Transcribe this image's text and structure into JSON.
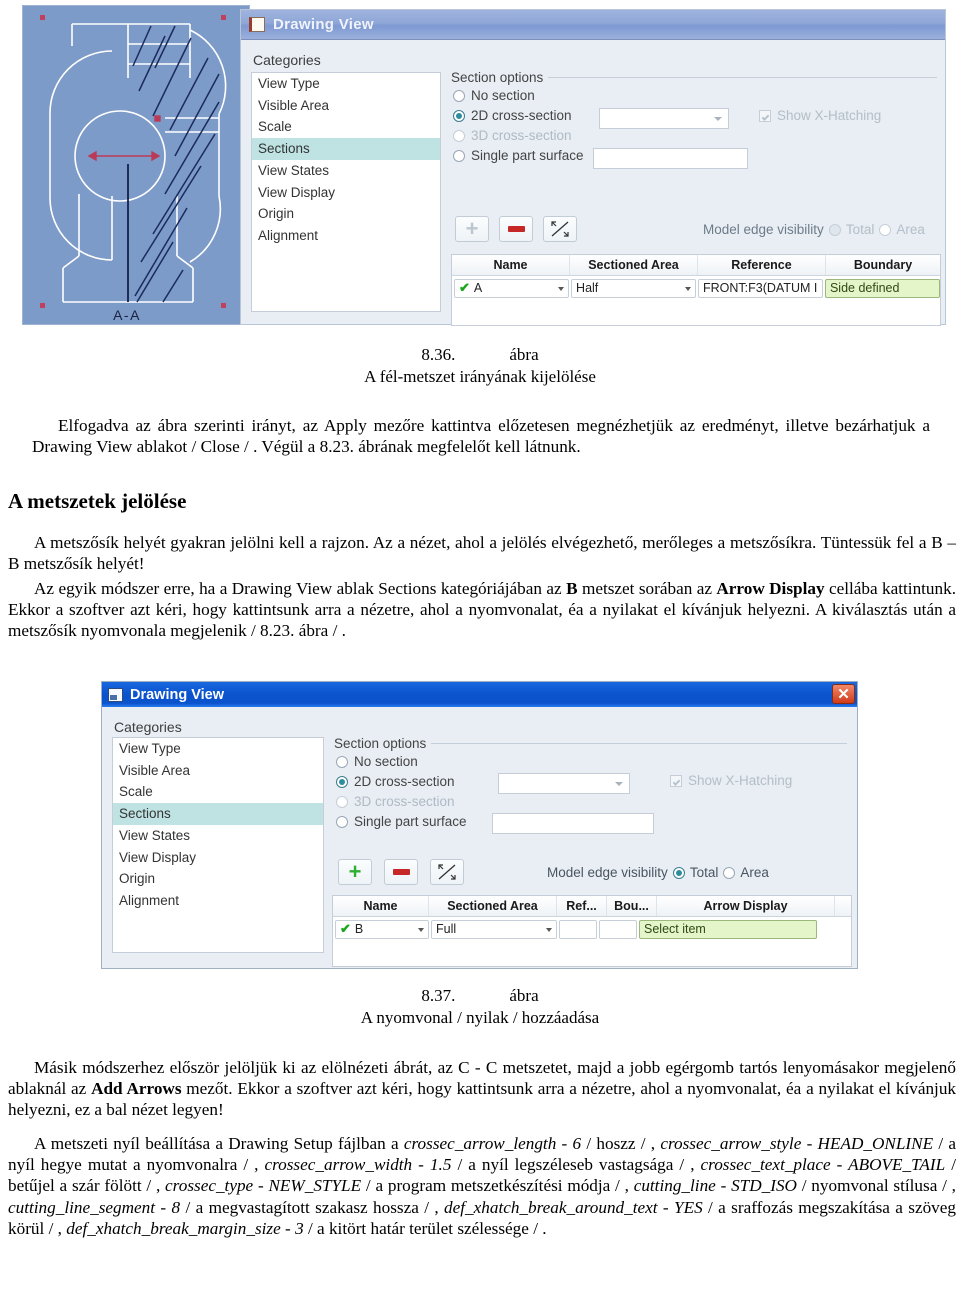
{
  "figure1": {
    "drawing": {
      "label": "A-A",
      "bg_color": "#7d9bc8",
      "line_color": "#ffffff",
      "hatch_color": "#1b2a5c",
      "marker_color": "#c23b5a"
    },
    "dialog": {
      "title": "Drawing View",
      "window_icon": "window-icon",
      "categories_label": "Categories",
      "categories": [
        "View Type",
        "Visible Area",
        "Scale",
        "Sections",
        "View States",
        "View Display",
        "Origin",
        "Alignment"
      ],
      "selected_category": "Sections",
      "section_options_label": "Section options",
      "radios": [
        {
          "label": "No section",
          "checked": false,
          "disabled": false
        },
        {
          "label": "2D cross-section",
          "checked": true,
          "disabled": false
        },
        {
          "label": "3D cross-section",
          "checked": false,
          "disabled": true
        },
        {
          "label": "Single part surface",
          "checked": false,
          "disabled": false
        }
      ],
      "show_xhatching": {
        "label": "Show X-Hatching",
        "checked": true,
        "disabled": true
      },
      "buttons": [
        {
          "name": "add-section-button",
          "icon": "plus-icon",
          "state": "disabled"
        },
        {
          "name": "remove-section-button",
          "icon": "minus-icon",
          "state": "enabled"
        },
        {
          "name": "flip-section-button",
          "icon": "flip-arrows-icon",
          "state": "enabled"
        }
      ],
      "model_edge_visibility": {
        "label": "Model edge visibility",
        "options": [
          "Total",
          "Area"
        ],
        "selected": "Total",
        "disabled": true
      },
      "table": {
        "headers": [
          "Name",
          "Sectioned Area",
          "Reference",
          "Boundary"
        ],
        "rows": [
          {
            "name": "A",
            "checked": true,
            "sectioned_area": "Half",
            "reference": "FRONT:F3(DATUM I",
            "boundary": "Side defined"
          }
        ]
      }
    },
    "caption": {
      "number": "8.36.",
      "word": "ábra",
      "text": "A fél-metszet irányának kijelölése"
    }
  },
  "paragraph1": "Elfogadva az ábra szerinti irányt, az Apply mezőre kattintva előzetesen megnézhetjük az eredményt, illetve bezárhatjuk a Drawing View ablakot / Close / . Végül a 8.23. ábrának megfelelőt kell látnunk.",
  "heading1": "A metszetek jelölése",
  "paragraph2_a": "A metszősík helyét gyakran jelölni kell a rajzon. Az a nézet, ahol a jelölés elvégezhető, merőleges a metszősíkra. Tüntessük fel a B – B metszősík helyét!",
  "paragraph2_b": {
    "p1": "Az egyik módszer erre, ha a Drawing View ablak Sections kategóriájában az ",
    "b1": "B",
    "p2": " metszet sorában az ",
    "b2": "Arrow Display",
    "p3": " cellába kattintunk. Ekkor a szoftver azt kéri, hogy kattintsunk arra a nézetre, ahol a nyomvonalat, éa a nyilakat el kívánjuk helyezni. A kiválasztás után a metszősík nyomvonala megjelenik / 8.23. ábra / ."
  },
  "figure2": {
    "dialog": {
      "title": "Drawing View",
      "window_icon": "window-icon",
      "close_label": "✕",
      "categories_label": "Categories",
      "categories": [
        "View Type",
        "Visible Area",
        "Scale",
        "Sections",
        "View States",
        "View Display",
        "Origin",
        "Alignment"
      ],
      "selected_category": "Sections",
      "section_options_label": "Section options",
      "radios": [
        {
          "label": "No section",
          "checked": false,
          "disabled": false
        },
        {
          "label": "2D cross-section",
          "checked": true,
          "disabled": false
        },
        {
          "label": "3D cross-section",
          "checked": false,
          "disabled": true
        },
        {
          "label": "Single part surface",
          "checked": false,
          "disabled": false
        }
      ],
      "show_xhatching": {
        "label": "Show X-Hatching",
        "checked": true,
        "disabled": true
      },
      "buttons": [
        {
          "name": "add-section-button",
          "icon": "plus-icon",
          "state": "enabled"
        },
        {
          "name": "remove-section-button",
          "icon": "minus-icon",
          "state": "enabled"
        },
        {
          "name": "flip-section-button",
          "icon": "flip-arrows-icon",
          "state": "enabled"
        }
      ],
      "model_edge_visibility": {
        "label": "Model edge visibility",
        "options": [
          "Total",
          "Area"
        ],
        "selected": "Total",
        "disabled": false
      },
      "table": {
        "headers": [
          "Name",
          "Sectioned Area",
          "Ref...",
          "Bou...",
          "Arrow Display"
        ],
        "rows": [
          {
            "name": "B",
            "checked": true,
            "sectioned_area": "Full",
            "reference": "",
            "boundary": "",
            "arrow_display": "Select item"
          }
        ]
      }
    },
    "caption": {
      "number": "8.37.",
      "word": "ábra",
      "text": "A nyomvonal / nyilak / hozzáadása"
    }
  },
  "paragraph3": {
    "p1": "Másik módszerhez először jelöljük ki az elölnézeti ábrát, az C - C metszetet, majd a jobb egérgomb tartós lenyomásakor megjelenő ablaknál az ",
    "b1": "Add Arrows",
    "p2": " mezőt. Ekkor a szoftver azt kéri, hogy kattintsunk arra a nézetre, ahol a nyomvonalat, éa a nyilakat el kívánjuk helyezni, ez a bal nézet legyen!"
  },
  "paragraph4": {
    "t0": "A metszeti nyíl beállítása a Drawing Setup fájlban a ",
    "i1": "crossec_arrow_length",
    "t1": " - ",
    "i1v": "6",
    "t1b": " / hoszz / , ",
    "i2": "crossec_arrow_style",
    "t2": " - ",
    "i2v": "HEAD_ONLINE",
    "t2b": " / a nyíl hegye mutat a nyomvonalra / , ",
    "i3": "crossec_arrow_width",
    "t3": " - ",
    "i3v": "1.5",
    "t3b": " / a nyíl legszéleseb vastagsága / , ",
    "i4": "crossec_text_place",
    "t4": " - ",
    "i4v": "ABOVE_TAIL",
    "t4b": " / betűjel a szár fölött / , ",
    "i5": "crossec_type",
    "t5": " - ",
    "i5v": "NEW_STYLE",
    "t5b": " / a program metszetkészítési módja / , ",
    "i6": "cutting_line",
    "t6": " - ",
    "i6v": "STD_ISO",
    "t6b": " / nyomvonal stílusa / , ",
    "i7": "cutting_line_segment",
    "t7": " - ",
    "i7v": "8",
    "t7b": " / a megvastagított szakasz hossza / , ",
    "i8": "def_xhatch_break_around_text",
    "t8": " - ",
    "i8v": "YES",
    "t8b": " / a sraffozás megszakítása a szöveg körül / , ",
    "i9": "def_xhatch_break_margin_size",
    "t9": " - ",
    "i9v": "3",
    "t9b": " / a kitört határ terület szélessége / ."
  }
}
